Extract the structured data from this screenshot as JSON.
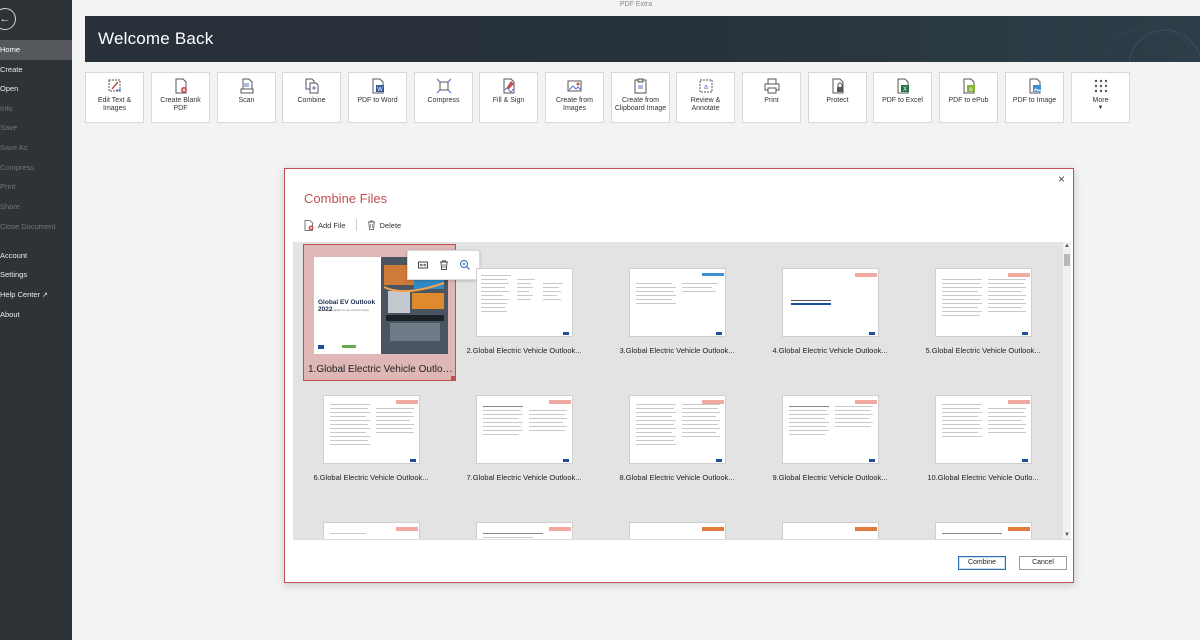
{
  "app_title": "PDF Extra",
  "sidebar": {
    "items": [
      {
        "label": "Home",
        "state": "active"
      },
      {
        "label": "Create",
        "state": "normal"
      },
      {
        "label": "Open",
        "state": "normal"
      },
      {
        "label": "Info",
        "state": "disabled"
      },
      {
        "label": "Save",
        "state": "disabled"
      },
      {
        "label": "Save As",
        "state": "disabled"
      },
      {
        "label": "Compress",
        "state": "disabled"
      },
      {
        "label": "Print",
        "state": "disabled"
      },
      {
        "label": "Share",
        "state": "disabled"
      },
      {
        "label": "Close Document",
        "state": "disabled"
      },
      {
        "label": "Account",
        "state": "normal"
      },
      {
        "label": "Settings",
        "state": "normal"
      },
      {
        "label": "Help Center",
        "state": "normal",
        "external": true
      },
      {
        "label": "About",
        "state": "normal"
      }
    ]
  },
  "banner": {
    "title": "Welcome Back"
  },
  "tools": [
    {
      "label": "Edit Text & Images",
      "icon": "edit-text-icon"
    },
    {
      "label": "Create Blank PDF",
      "icon": "create-pdf-icon"
    },
    {
      "label": "Scan",
      "icon": "scan-icon"
    },
    {
      "label": "Combine",
      "icon": "combine-icon"
    },
    {
      "label": "PDF to Word",
      "icon": "pdf-to-word-icon"
    },
    {
      "label": "Compress",
      "icon": "compress-icon"
    },
    {
      "label": "Fill & Sign",
      "icon": "fill-sign-icon"
    },
    {
      "label": "Create from Images",
      "icon": "image-icon"
    },
    {
      "label": "Create from Clipboard Image",
      "icon": "clipboard-icon"
    },
    {
      "label": "Review & Annotate",
      "icon": "annotate-icon"
    },
    {
      "label": "Print",
      "icon": "print-icon"
    },
    {
      "label": "Protect",
      "icon": "protect-icon"
    },
    {
      "label": "PDF to Excel",
      "icon": "pdf-to-excel-icon"
    },
    {
      "label": "PDF to ePub",
      "icon": "pdf-to-epub-icon"
    },
    {
      "label": "PDF to Image",
      "icon": "pdf-to-image-icon"
    },
    {
      "label": "More",
      "icon": "more-grid-icon",
      "has_dropdown": true
    }
  ],
  "dialog": {
    "title": "Combine Files",
    "close_glyph": "×",
    "add_file_label": "Add File",
    "delete_label": "Delete",
    "combine_label": "Combine",
    "cancel_label": "Cancel",
    "cover": {
      "title": "Global EV Outlook 2022",
      "subtitle": "Securing supplies for an electric future"
    },
    "files": [
      "1.Global Electric Vehicle Outlook...",
      "2.Global Electric Vehicle Outlook...",
      "3.Global Electric Vehicle Outlook...",
      "4.Global Electric Vehicle Outlook...",
      "5.Global Electric Vehicle Outlook...",
      "6.Global Electric Vehicle Outlook...",
      "7.Global Electric Vehicle Outlook...",
      "8.Global Electric Vehicle Outlook...",
      "9.Global Electric Vehicle Outlook...",
      "10.Global Electric Vehicle Outlo..."
    ],
    "selected_index": 0
  },
  "colors": {
    "accent": "#c0504d",
    "sidebar_bg": "#2e3338",
    "banner_bg": "#283039",
    "primary_button_border": "#2f6cb4"
  }
}
